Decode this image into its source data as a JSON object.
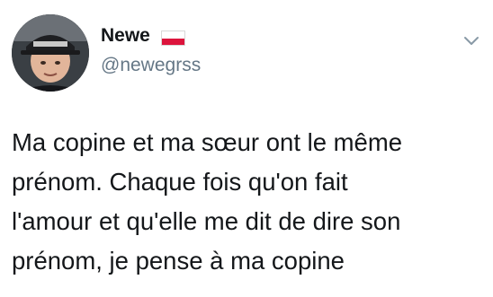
{
  "tweet": {
    "author": {
      "display_name": "Newe",
      "handle": "@newegrss",
      "flag_icon": "poland-flag-icon",
      "avatar": "user-avatar"
    },
    "menu_icon": "chevron-down-icon",
    "text": "Ma copine et ma sœur ont le même\nprénom. Chaque fois qu'on fait\nl'amour et qu'elle me dit de dire son\nprénom, je pense à ma copine",
    "colors": {
      "text": "#14171a",
      "handle": "#657786",
      "flag_white": "#ffffff",
      "flag_red": "#dc143c"
    }
  }
}
